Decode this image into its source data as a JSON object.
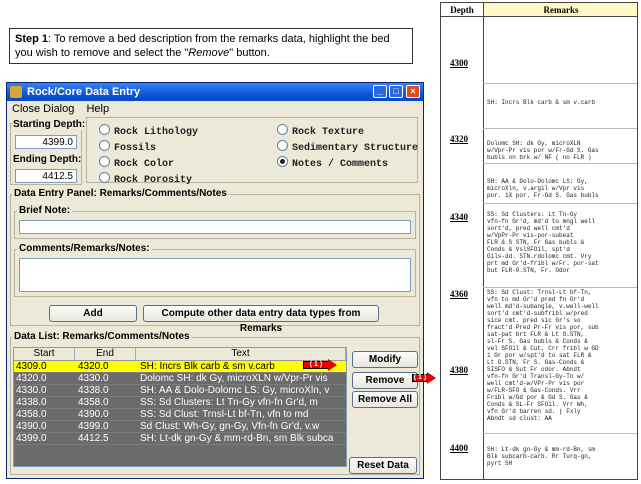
{
  "instruction": {
    "step": "Step 1",
    "text_before": ": To remove a bed description from the remarks data, highlight the bed you wish to remove and select the \"",
    "emph": "Remove",
    "text_after": "\" button."
  },
  "window": {
    "title": "Rock/Core Data Entry",
    "menu": [
      "Close Dialog",
      "Help"
    ],
    "starting_depth_label": "Starting Depth:",
    "starting_depth_value": "4399.0",
    "ending_depth_label": "Ending Depth:",
    "ending_depth_value": "4412.5",
    "radios": [
      {
        "label": "Rock Lithology",
        "checked": false
      },
      {
        "label": "Rock Texture",
        "checked": false
      },
      {
        "label": "Fossils",
        "checked": false
      },
      {
        "label": "Sedimentary Structure",
        "checked": false
      },
      {
        "label": "Rock Color",
        "checked": false
      },
      {
        "label": "Notes / Comments",
        "checked": true
      },
      {
        "label": "Rock Porosity",
        "checked": false
      }
    ],
    "panel_title": "Data Entry Panel: Remarks/Comments/Notes",
    "brief_note_label": "Brief Note:",
    "comments_label": "Comments/Remarks/Notes:",
    "add_label": "Add",
    "compute_label": "Compute other data entry data types from Remarks",
    "list_title": "Data List: Remarks/Comments/Notes",
    "columns": [
      "Start",
      "End",
      "Text"
    ],
    "rows": [
      {
        "start": "4309.0",
        "end": "4320.0",
        "text": "SH: Incrs Blk carb & sm v.carb"
      },
      {
        "start": "4320.0",
        "end": "4330.0",
        "text": "Dolomc SH: dk Gy, microXLN w/Vpr-Pr vis"
      },
      {
        "start": "4330.0",
        "end": "4338.0",
        "text": "SH: AA & Dolo-Dolomc LS: Gy, microXln, v"
      },
      {
        "start": "4338.0",
        "end": "4358.0",
        "text": "SS: Sd Clusters: Lt Tn-Gy vfn-fn Gr'd, m"
      },
      {
        "start": "4358.0",
        "end": "4390.0",
        "text": "SS: Sd Clust: Trnsl-Lt bf-Tn, vfn to md"
      },
      {
        "start": "4390.0",
        "end": "4399.0",
        "text": "Sd Clust: Wh-Gy, gn-Gy, Vfn-fn Gr'd, v.w"
      },
      {
        "start": "4399.0",
        "end": "4412.5",
        "text": "SH: Lt-dk gn-Gy & mm-rd-Bn, sm Blk subca"
      }
    ],
    "modify_label": "Modify",
    "remove_label": "Remove",
    "remove_all_label": "Remove All",
    "reset_label": "Reset Data",
    "arrow_label": "( 1 )"
  },
  "log": {
    "depth_header": "Depth",
    "remarks_header": "Remarks",
    "depths": [
      "4300",
      "4320",
      "4340",
      "4360",
      "4380",
      "4400"
    ],
    "remarks": [
      "SH: Incrs Blk carb & sm v.carb",
      "Dolomc SH: dk Gy, microXLN\nw/Vpr-Pr vis por w/Fr-Gd S. Gas\nbubls on brk w/ NF ( no FLR )",
      "SH: AA & Dolo-Dolomc LS: Gy,\nmicroXln, v.argil w/Vpr vis\npor. 1X por. Fr-Gd S. Gas bubls",
      "SS: Sd Clusters: Lt Tn-Gy\nvfn-fn Gr'd, md'd to mngl well\nsort'd, pred well cmt'd\nw/VpPr-Pr vis-por-subeat\nFLR & S STN, Fr Gas bubls &\nConds & VslSFOil, spt'd\nGils-dd. STN.rdolomc cmt. Vry\nprt md Gr'd-fribl w/Fr. por-sat\nbut FLR-0.STN, Fr. Odor",
      "SS: Sd Clust: Trnsl-Lt bf-Tn,\nvfn to md Gr'd pred fn Gr'd\nwell md'd-subangle, v.well-well\nsort'd cmt'd-subfribl w/pred\nsice cmt. pred sic Gr's so\nfract'd Pred Pr-Fr vis por, sub\nsat-pat brt FLR & Lt O.STN,\nsl-Fr S. Gas bubls & Conds &\nvel SFOil & Cut, Crr fribl w GD\n1 Gr por w/spt'd to sat FLR &\nLt O.STN, Fr S. Gas-Conds &\nSISFO & Sut Fr odor. Abndt\nvfn-fn Gr'd Transl-Gy-Tn w/\nwell cmt'd-w/VPr-Pr vis por\nw/FLR-SFO & Gas-Conds. Vrr\nFribl w/Gd por & Gd S. Gas &\nConds & SL-Fr SFOil. Vrr Wh,\nvfn Gr'd barren sd. ( Fxly\nAbndt sd clust: AA",
      "SH: Lt-dk gn-Gy & mm-rd-Bn, sm\nBlk subcarb-carb. Rr Turq-gn,\npyrt SH"
    ]
  }
}
